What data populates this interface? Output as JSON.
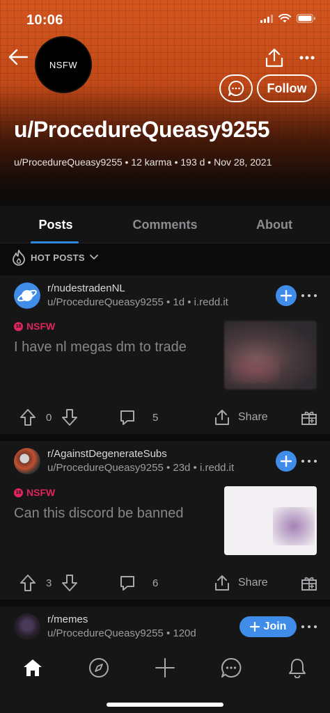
{
  "status_bar": {
    "time": "10:06"
  },
  "profile": {
    "avatar_text": "NSFW",
    "follow_label": "Follow",
    "username": "u/ProcedureQueasy9255",
    "meta": "u/ProcedureQueasy9255 • 12 karma • 193 d • Nov 28, 2021"
  },
  "tabs": [
    {
      "label": "Posts",
      "active": true
    },
    {
      "label": "Comments",
      "active": false
    },
    {
      "label": "About",
      "active": false
    }
  ],
  "sort": {
    "label": "HOT POSTS"
  },
  "posts": [
    {
      "subreddit": "r/nudestradenNL",
      "meta": "u/ProcedureQueasy9255 • 1d • i.redd.it",
      "nsfw_label": "NSFW",
      "title": "I have nl megas dm to trade",
      "votes": "0",
      "comments": "5",
      "share_label": "Share"
    },
    {
      "subreddit": "r/AgainstDegenerateSubs",
      "meta": "u/ProcedureQueasy9255 • 23d • i.redd.it",
      "nsfw_label": "NSFW",
      "title": "Can this discord be banned",
      "votes": "3",
      "comments": "6",
      "share_label": "Share"
    },
    {
      "subreddit": "r/memes",
      "meta": "u/ProcedureQueasy9255 • 120d",
      "join_label": "Join"
    }
  ],
  "colors": {
    "accent": "#3f8de8",
    "nsfw": "#e0245e",
    "header": "#c04817"
  }
}
